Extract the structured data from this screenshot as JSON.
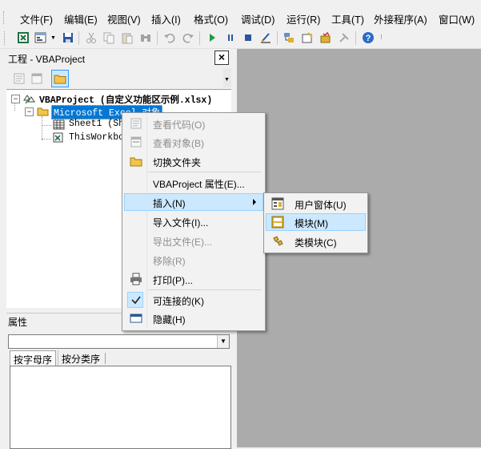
{
  "menubar": {
    "items": [
      "文件(F)",
      "编辑(E)",
      "视图(V)",
      "插入(I)",
      "格式(O)",
      "调试(D)",
      "运行(R)",
      "工具(T)",
      "外接程序(A)",
      "窗口(W)"
    ]
  },
  "project_window": {
    "title": "工程 - VBAProject",
    "close_glyph": "×",
    "tree": {
      "root": "VBAProject (自定义功能区示例.xlsx)",
      "folder": "Microsoft Excel 对象",
      "sheet1": "Sheet1 (She",
      "thisworkbook": "ThisWorkboo"
    }
  },
  "properties_window": {
    "title": "属性",
    "tabs": [
      "按字母序",
      "按分类序"
    ]
  },
  "context_menu": {
    "items": [
      {
        "label": "查看代码(O)",
        "enabled": false,
        "icon": "view-code-icon"
      },
      {
        "label": "查看对象(B)",
        "enabled": false,
        "icon": "view-object-icon"
      },
      {
        "label": "切换文件夹",
        "enabled": true,
        "icon": "folder-icon"
      },
      {
        "label": "VBAProject 属性(E)...",
        "enabled": true
      },
      {
        "label": "插入(N)",
        "enabled": true,
        "submenu": true,
        "highlighted": true
      },
      {
        "label": "导入文件(I)...",
        "enabled": true
      },
      {
        "label": "导出文件(E)...",
        "enabled": false
      },
      {
        "label": "移除(R)",
        "enabled": false
      },
      {
        "label": "打印(P)...",
        "enabled": true,
        "icon": "print-icon"
      },
      {
        "label": "可连接的(K)",
        "enabled": true,
        "checked": true,
        "icon": "checkmark-icon"
      },
      {
        "label": "隐藏(H)",
        "enabled": true,
        "icon": "hide-window-icon"
      }
    ]
  },
  "insert_submenu": {
    "items": [
      {
        "label": "用户窗体(U)",
        "icon": "userform-icon"
      },
      {
        "label": "模块(M)",
        "icon": "module-icon",
        "highlighted": true
      },
      {
        "label": "类模块(C)",
        "icon": "class-module-icon"
      }
    ]
  },
  "colors": {
    "highlight_bg": "#cce8ff",
    "highlight_border": "#99d1ff",
    "mdi_background": "#ababab",
    "tree_selection": "#0078d7"
  }
}
